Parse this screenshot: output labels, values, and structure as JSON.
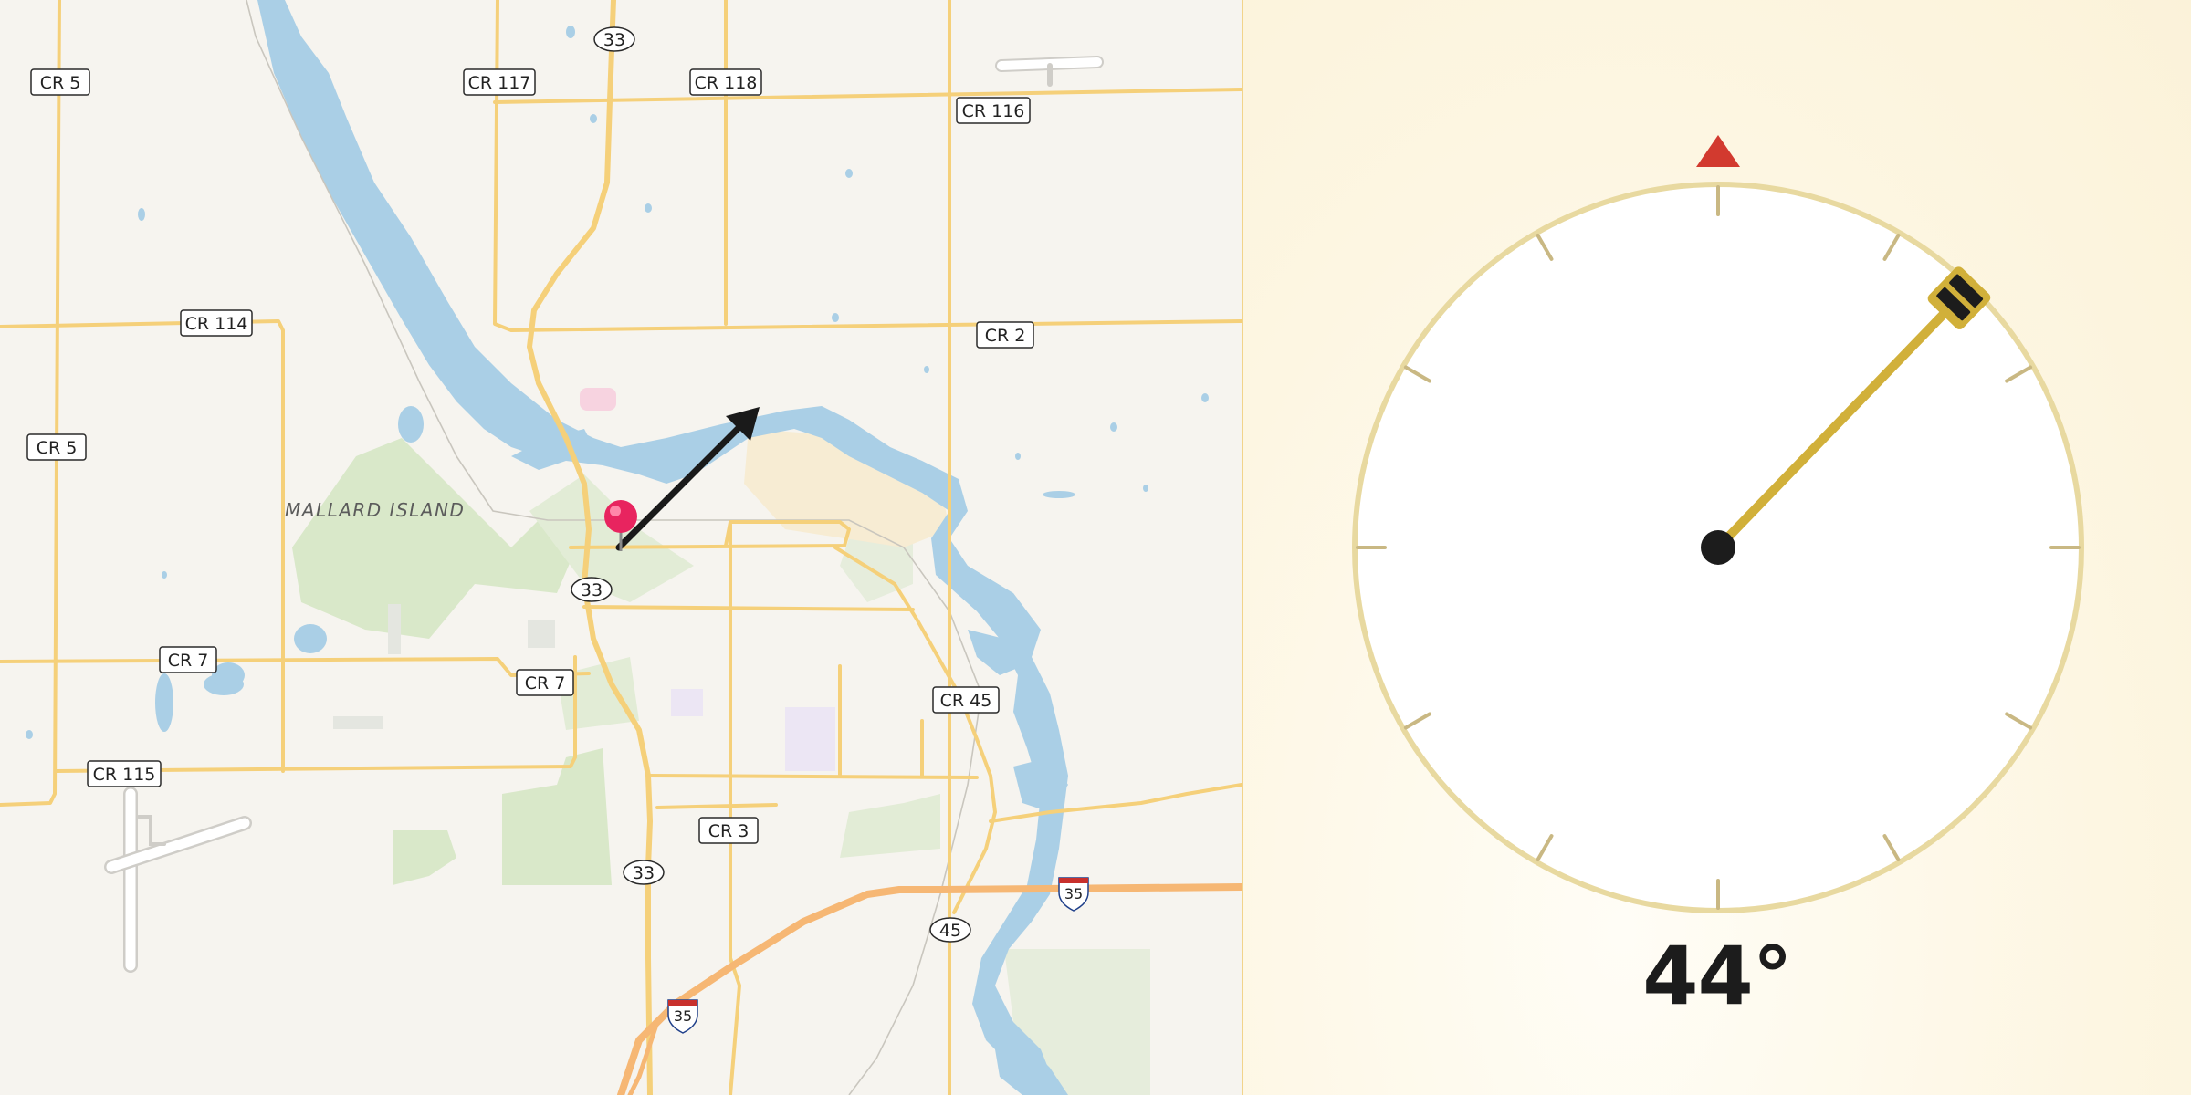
{
  "map": {
    "place_label": "MALLARD ISLAND",
    "road_labels": {
      "cr5_north": "CR 5",
      "cr5_mid": "CR 5",
      "cr117": "CR 117",
      "cr118": "CR 118",
      "cr116": "CR 116",
      "cr114": "CR 114",
      "cr2": "CR 2",
      "cr7_west": "CR 7",
      "cr7_east": "CR 7",
      "cr45": "CR 45",
      "cr115": "CR 115",
      "cr3": "CR 3",
      "hwy33_north": "33",
      "hwy33_mid": "33",
      "hwy33_south": "33",
      "hwy45": "45",
      "i35_east": "35",
      "i35_south": "35"
    },
    "pin_icon": "map-pin-icon",
    "direction_arrow_icon": "direction-arrow-icon",
    "colors": {
      "water": "#aacfe6",
      "road": "#f5d07a",
      "interstate": "#f6b774",
      "park": "#d7e8c8",
      "pin": "#e8245f"
    }
  },
  "compass": {
    "heading_degrees": 44,
    "heading_text": "44°",
    "north_marker_icon": "north-triangle-icon",
    "colors": {
      "ring": "#e8d9a0",
      "needle": "#d1b03a",
      "north_marker": "#d23a2f"
    }
  }
}
